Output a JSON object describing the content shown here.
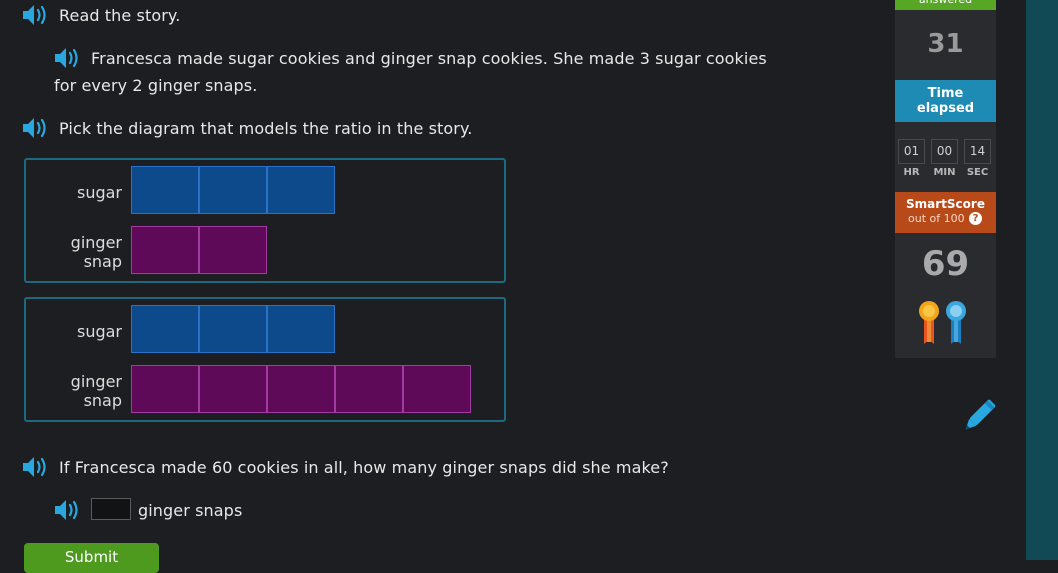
{
  "question": {
    "intro": "Read the story.",
    "story_line1": "Francesca made sugar cookies and ginger snap cookies. She made 3 sugar cookies",
    "story_line2": "for every 2 ginger snaps.",
    "prompt": "Pick the diagram that models the ratio in the story.",
    "followup": "If Francesca made 60 cookies in all, how many ginger snaps did she make?",
    "answer_unit": "ginger snaps",
    "answer_value": "",
    "submit_label": "Submit"
  },
  "diagrams": [
    {
      "sugar_label": "sugar",
      "ginger_label_1": "ginger",
      "ginger_label_2": "snap",
      "sugar_count": 3,
      "ginger_count": 2
    },
    {
      "sugar_label": "sugar",
      "ginger_label_1": "ginger",
      "ginger_label_2": "snap",
      "sugar_count": 3,
      "ginger_count": 5
    }
  ],
  "sidebar": {
    "answered_label": "answered",
    "answered_count": "31",
    "time_label_1": "Time",
    "time_label_2": "elapsed",
    "hours": "01",
    "minutes": "00",
    "seconds": "14",
    "hr_label": "HR",
    "min_label": "MIN",
    "sec_label": "SEC",
    "smartscore_label": "SmartScore",
    "smartscore_sub": "out of 100",
    "help_symbol": "?",
    "smartscore": "69"
  },
  "colors": {
    "sugar": "#0c4a8c",
    "ginger": "#5e0a58",
    "accent": "#1e8bb5",
    "smartscore": "#b84a19",
    "answered": "#57a626"
  },
  "icons": [
    "speaker-icon",
    "pencil-icon",
    "medal-icon",
    "help-icon"
  ]
}
